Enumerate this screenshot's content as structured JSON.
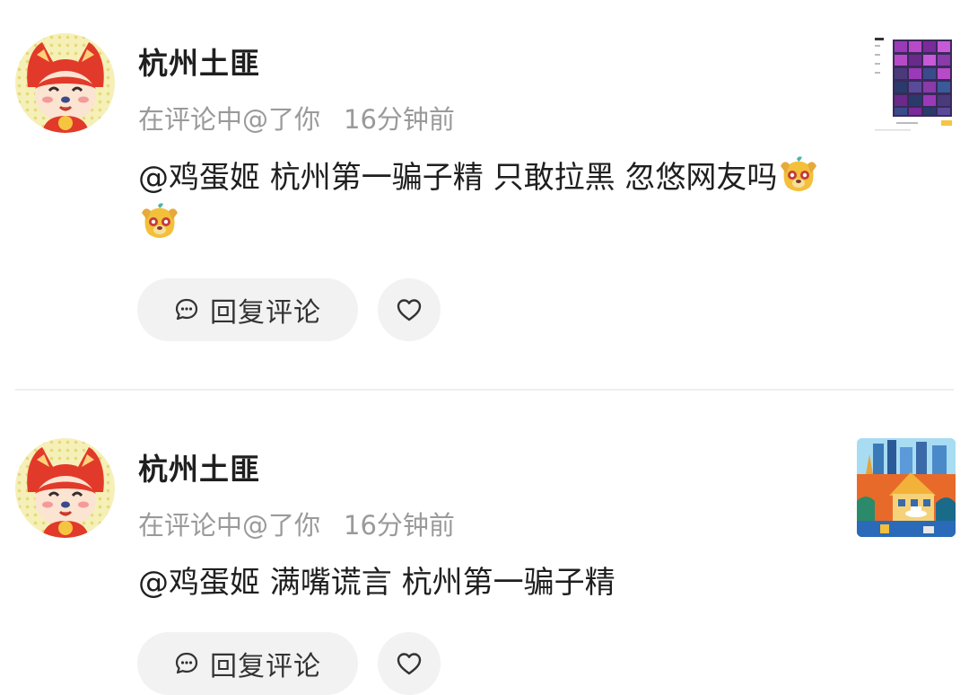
{
  "colors": {
    "username": "#1f1f1f",
    "meta": "#9a9a9a",
    "button_bg": "#f2f2f2",
    "divider": "#eeeeee",
    "avatar_red": "#e23a2a",
    "avatar_bg": "#f5f0b8"
  },
  "notifications": [
    {
      "username": "杭州土匪",
      "action": "在评论中@了你",
      "time": "16分钟前",
      "comment": "@鸡蛋姬 杭州第一骗子精 只敢拉黑 忽悠网友吗",
      "emojis": [
        "dog-face-emoji",
        "dog-face-emoji"
      ],
      "reply_label": "回复评论",
      "reply_icon": "chat-bubble-icon",
      "like_icon": "heart-icon",
      "avatar_icon": "red-fox-cartoon-avatar",
      "thumbnail_icon": "purple-image-grid-thumbnail"
    },
    {
      "username": "杭州土匪",
      "action": "在评论中@了你",
      "time": "16分钟前",
      "comment": "@鸡蛋姬 满嘴谎言 杭州第一骗子精",
      "emojis": [],
      "reply_label": "回复评论",
      "reply_icon": "chat-bubble-icon",
      "like_icon": "heart-icon",
      "avatar_icon": "red-fox-cartoon-avatar",
      "thumbnail_icon": "colorful-city-illustration-thumbnail"
    }
  ]
}
